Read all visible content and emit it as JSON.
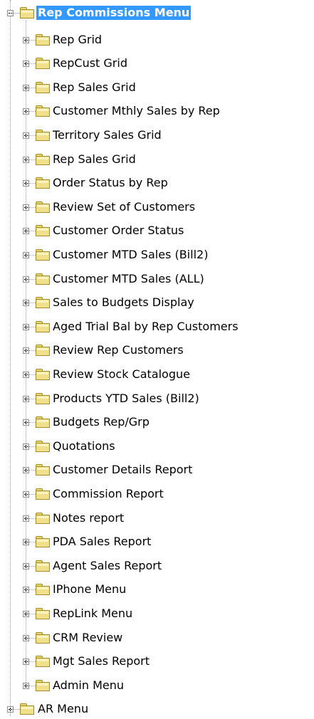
{
  "tree": {
    "root": {
      "label": "Rep Commissions Menu",
      "expanded": true,
      "selected": true
    },
    "children": [
      {
        "label": "Rep Grid"
      },
      {
        "label": "RepCust Grid"
      },
      {
        "label": "Rep Sales Grid"
      },
      {
        "label": "Customer Mthly Sales by Rep"
      },
      {
        "label": "Territory Sales Grid"
      },
      {
        "label": "Rep Sales Grid"
      },
      {
        "label": "Order Status by Rep"
      },
      {
        "label": "Review Set of Customers"
      },
      {
        "label": "Customer Order Status"
      },
      {
        "label": "Customer MTD Sales (Bill2)"
      },
      {
        "label": "Customer MTD Sales (ALL)"
      },
      {
        "label": "Sales to Budgets Display"
      },
      {
        "label": "Aged Trial Bal by Rep Customers"
      },
      {
        "label": "Review Rep Customers"
      },
      {
        "label": "Review Stock Catalogue"
      },
      {
        "label": "Products YTD Sales (Bill2)"
      },
      {
        "label": "Budgets Rep/Grp"
      },
      {
        "label": "Quotations"
      },
      {
        "label": "Customer Details Report"
      },
      {
        "label": "Commission Report"
      },
      {
        "label": "Notes report"
      },
      {
        "label": "PDA Sales Report"
      },
      {
        "label": "Agent Sales Report"
      },
      {
        "label": "IPhone Menu"
      },
      {
        "label": "RepLink Menu"
      },
      {
        "label": "CRM Review"
      },
      {
        "label": "Mgt Sales Report"
      },
      {
        "label": "Admin Menu"
      }
    ],
    "next_sibling": {
      "label": "AR Menu"
    }
  },
  "colors": {
    "selection": "#3399ff",
    "folder": "#f1e08a",
    "folder_border": "#a38d2a",
    "tree_lines": "#a0a0a0"
  },
  "icons": {
    "expander_expanded": "minus-box-icon",
    "expander_collapsed": "plus-box-icon",
    "folder_closed": "folder-icon",
    "folder_open": "folder-open-icon"
  }
}
